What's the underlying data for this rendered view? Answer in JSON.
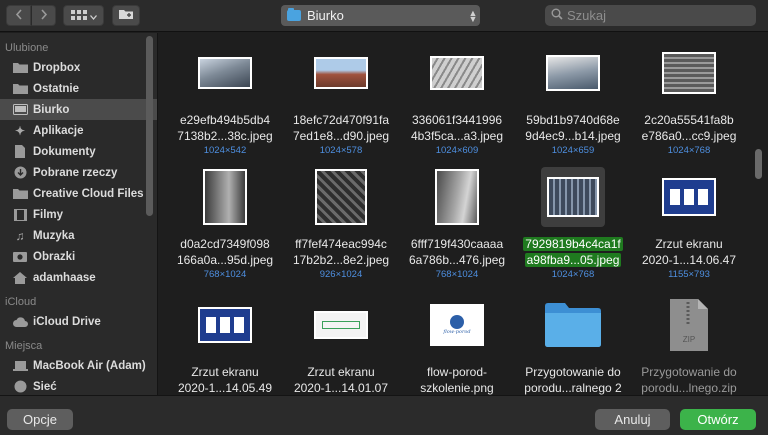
{
  "toolbar": {
    "location": "Biurko",
    "search_placeholder": "Szukaj"
  },
  "sidebar": {
    "sections": [
      {
        "header": "Ulubione",
        "items": [
          {
            "label": "Dropbox",
            "icon": "folder-icon"
          },
          {
            "label": "Ostatnie",
            "icon": "recents-icon"
          },
          {
            "label": "Biurko",
            "icon": "desktop-icon",
            "selected": true
          },
          {
            "label": "Aplikacje",
            "icon": "applications-icon"
          },
          {
            "label": "Dokumenty",
            "icon": "documents-icon"
          },
          {
            "label": "Pobrane rzeczy",
            "icon": "downloads-icon"
          },
          {
            "label": "Creative Cloud Files",
            "icon": "folder-icon"
          },
          {
            "label": "Filmy",
            "icon": "movies-icon"
          },
          {
            "label": "Muzyka",
            "icon": "music-icon"
          },
          {
            "label": "Obrazki",
            "icon": "pictures-icon"
          },
          {
            "label": "adamhaase",
            "icon": "home-icon"
          }
        ]
      },
      {
        "header": "iCloud",
        "items": [
          {
            "label": "iCloud Drive",
            "icon": "cloud-icon"
          }
        ]
      },
      {
        "header": "Miejsca",
        "items": [
          {
            "label": "MacBook Air (Adam)",
            "icon": "laptop-icon"
          },
          {
            "label": "Sieć",
            "icon": "network-icon"
          }
        ]
      }
    ]
  },
  "files": [
    {
      "line1": "e29efb494b5db4",
      "line2": "7138b2...38c.jpeg",
      "dims": "1024×542"
    },
    {
      "line1": "18efc72d470f91fa",
      "line2": "7ed1e8...d90.jpeg",
      "dims": "1024×578"
    },
    {
      "line1": "336061f3441996",
      "line2": "4b3f5ca...a3.jpeg",
      "dims": "1024×609"
    },
    {
      "line1": "59bd1b9740d68e",
      "line2": "9d4ec9...b14.jpeg",
      "dims": "1024×659"
    },
    {
      "line1": "2c20a55541fa8b",
      "line2": "e786a0...cc9.jpeg",
      "dims": "1024×768"
    },
    {
      "line1": "d0a2cd7349f098",
      "line2": "166a0a...95d.jpeg",
      "dims": "768×1024"
    },
    {
      "line1": "ff7fef474eac994c",
      "line2": "17b2b2...8e2.jpeg",
      "dims": "926×1024"
    },
    {
      "line1": "6fff719f430caaaa",
      "line2": "6a786b...476.jpeg",
      "dims": "768×1024"
    },
    {
      "line1": "7929819b4c4ca1f",
      "line2": "a98fba9...05.jpeg",
      "dims": "1024×768",
      "selected": true
    },
    {
      "line1": "Zrzut ekranu",
      "line2": "2020-1...14.06.47",
      "dims": "1155×793"
    },
    {
      "line1": "Zrzut ekranu",
      "line2": "2020-1...14.05.49",
      "dims": ""
    },
    {
      "line1": "Zrzut ekranu",
      "line2": "2020-1...14.01.07",
      "dims": ""
    },
    {
      "line1": "flow-porod-",
      "line2": "szkolenie.png",
      "dims": "",
      "logo_text": "flow-porod"
    },
    {
      "line1": "Przygotowanie do",
      "line2": "porodu...ralnego 2",
      "dims": "",
      "kind": "folder"
    },
    {
      "line1": "Przygotowanie do",
      "line2": "porodu...lnego.zip",
      "dims": "",
      "kind": "zip",
      "dim": true,
      "zip_label": "ZIP"
    }
  ],
  "buttons": {
    "options": "Opcje",
    "cancel": "Anuluj",
    "open": "Otwórz"
  },
  "colors": {
    "accent_green": "#3cb34a",
    "selection_green": "#1f7a1f",
    "dims_blue": "#4e8fe0",
    "folder_blue": "#4aa3e0"
  }
}
